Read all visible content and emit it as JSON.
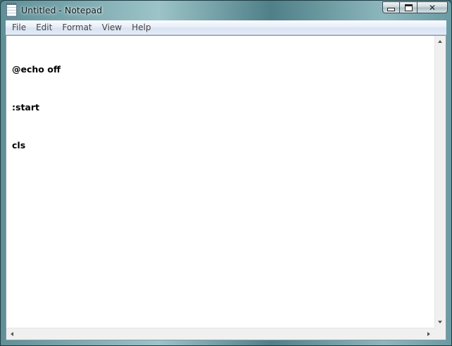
{
  "window": {
    "title": "Untitled - Notepad",
    "accent_color": "#7fb0b6"
  },
  "caption_buttons": {
    "minimize_icon": "minimize-icon",
    "maximize_icon": "maximize-icon",
    "close_icon": "close-icon",
    "close_glyph": "✕"
  },
  "menubar": {
    "items": [
      {
        "label": "File"
      },
      {
        "label": "Edit"
      },
      {
        "label": "Format"
      },
      {
        "label": "View"
      },
      {
        "label": "Help"
      }
    ]
  },
  "editor": {
    "lines": [
      "@echo off",
      ":start",
      "cls"
    ]
  }
}
